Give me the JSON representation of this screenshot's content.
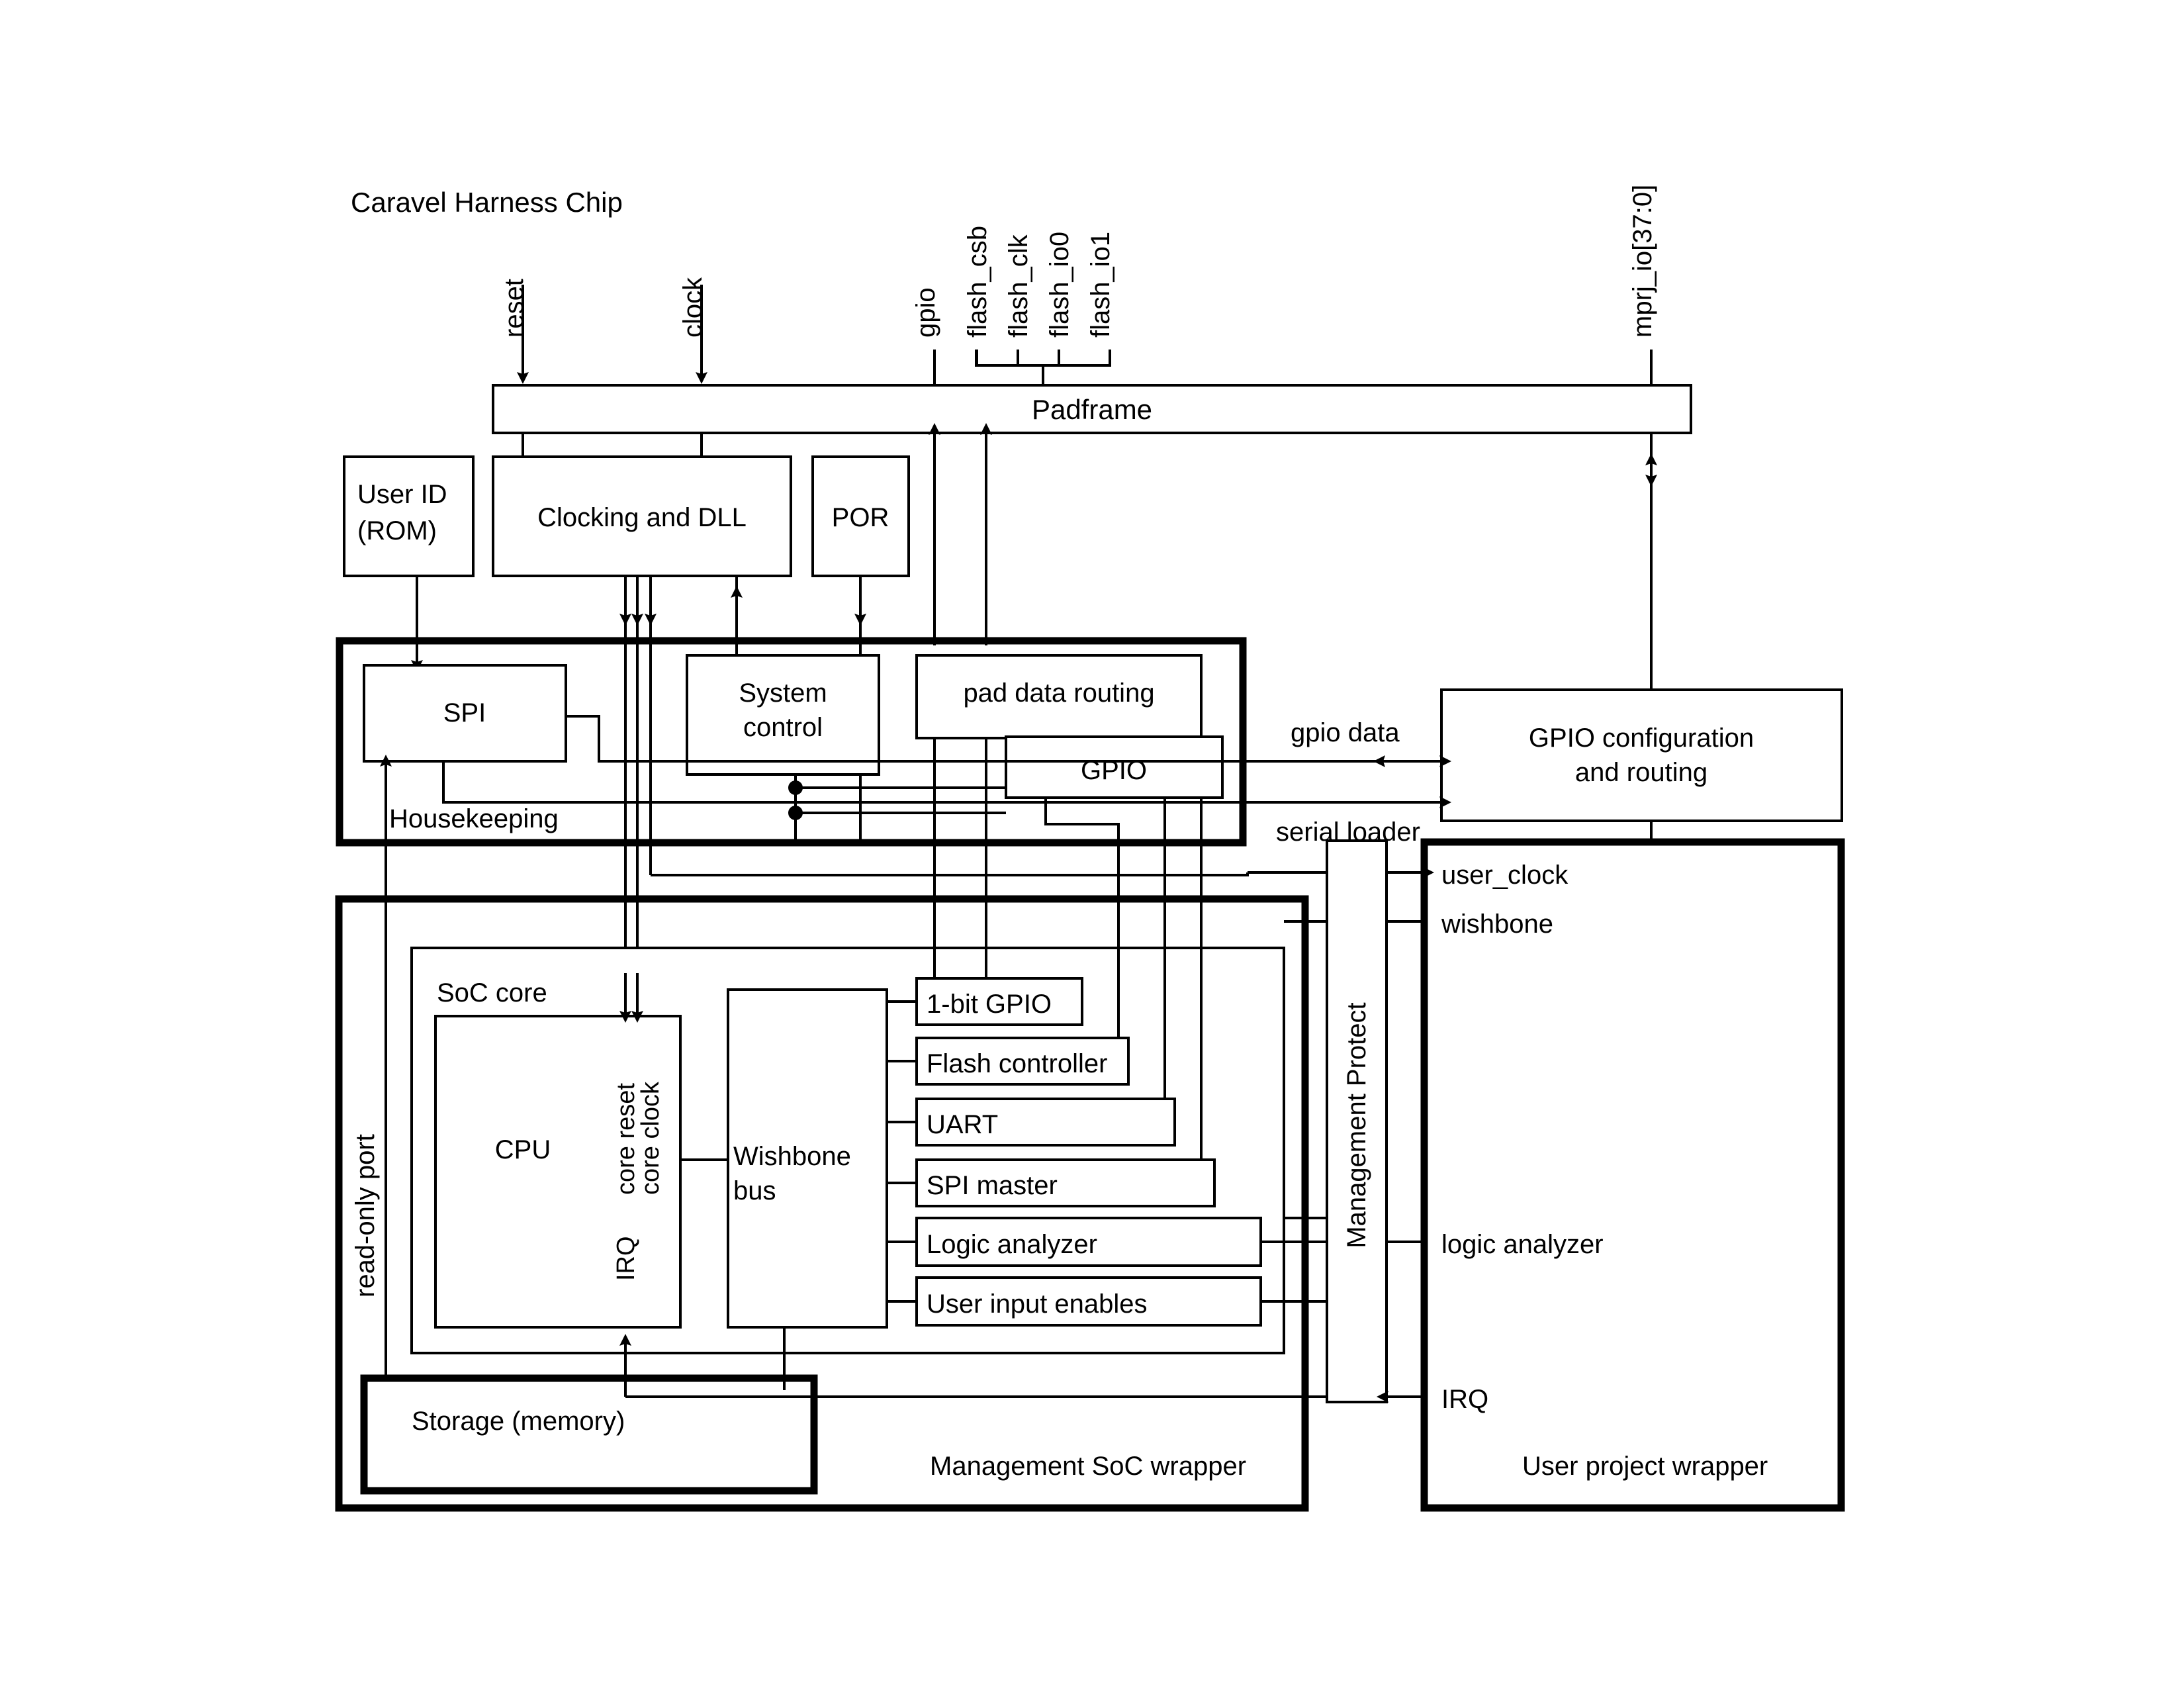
{
  "diagram": {
    "title": "Caravel Harness Chip",
    "type": "block-diagram"
  },
  "top_signals": [
    {
      "name": "reset"
    },
    {
      "name": "clock"
    },
    {
      "name": "gpio"
    },
    {
      "name": "flash_csb"
    },
    {
      "name": "flash_clk"
    },
    {
      "name": "flash_io0"
    },
    {
      "name": "flash_io1"
    },
    {
      "name": "mprj_io[37:0]"
    }
  ],
  "blocks": {
    "padframe": "Padframe",
    "user_id_rom_line1": "User ID",
    "user_id_rom_line2": "(ROM)",
    "clocking_dll": "Clocking and DLL",
    "por": "POR",
    "housekeeping": "Housekeeping",
    "spi": "SPI",
    "system_control_line1": "System",
    "system_control_line2": "control",
    "pad_data_routing": "pad data routing",
    "gpio": "GPIO",
    "gpio_config_line1": "GPIO configuration",
    "gpio_config_line2": "and routing",
    "management_soc_wrapper": "Management SoC wrapper",
    "soc_core": "SoC core",
    "cpu": "CPU",
    "wishbone_bus_line1": "Wishbone",
    "wishbone_bus_line2": "bus",
    "storage_memory": "Storage (memory)",
    "management_protect": "Management Protect",
    "user_project_wrapper": "User project wrapper"
  },
  "peripherals": [
    {
      "label": "1-bit GPIO"
    },
    {
      "label": "Flash controller"
    },
    {
      "label": "UART"
    },
    {
      "label": "SPI master"
    },
    {
      "label": "Logic analyzer"
    },
    {
      "label": "User input enables"
    }
  ],
  "wire_labels": {
    "gpio_data": "gpio data",
    "serial_loader": "serial loader",
    "read_only_port": "read-only port",
    "irq": "IRQ",
    "core_reset": "core reset",
    "core_clock": "core clock"
  },
  "user_ports": [
    {
      "label": "user_clock"
    },
    {
      "label": "wishbone"
    },
    {
      "label": "logic analyzer"
    },
    {
      "label": "IRQ"
    }
  ],
  "colors": {
    "stroke": "#000000",
    "fill": "#ffffff",
    "background": "#ffffff"
  }
}
